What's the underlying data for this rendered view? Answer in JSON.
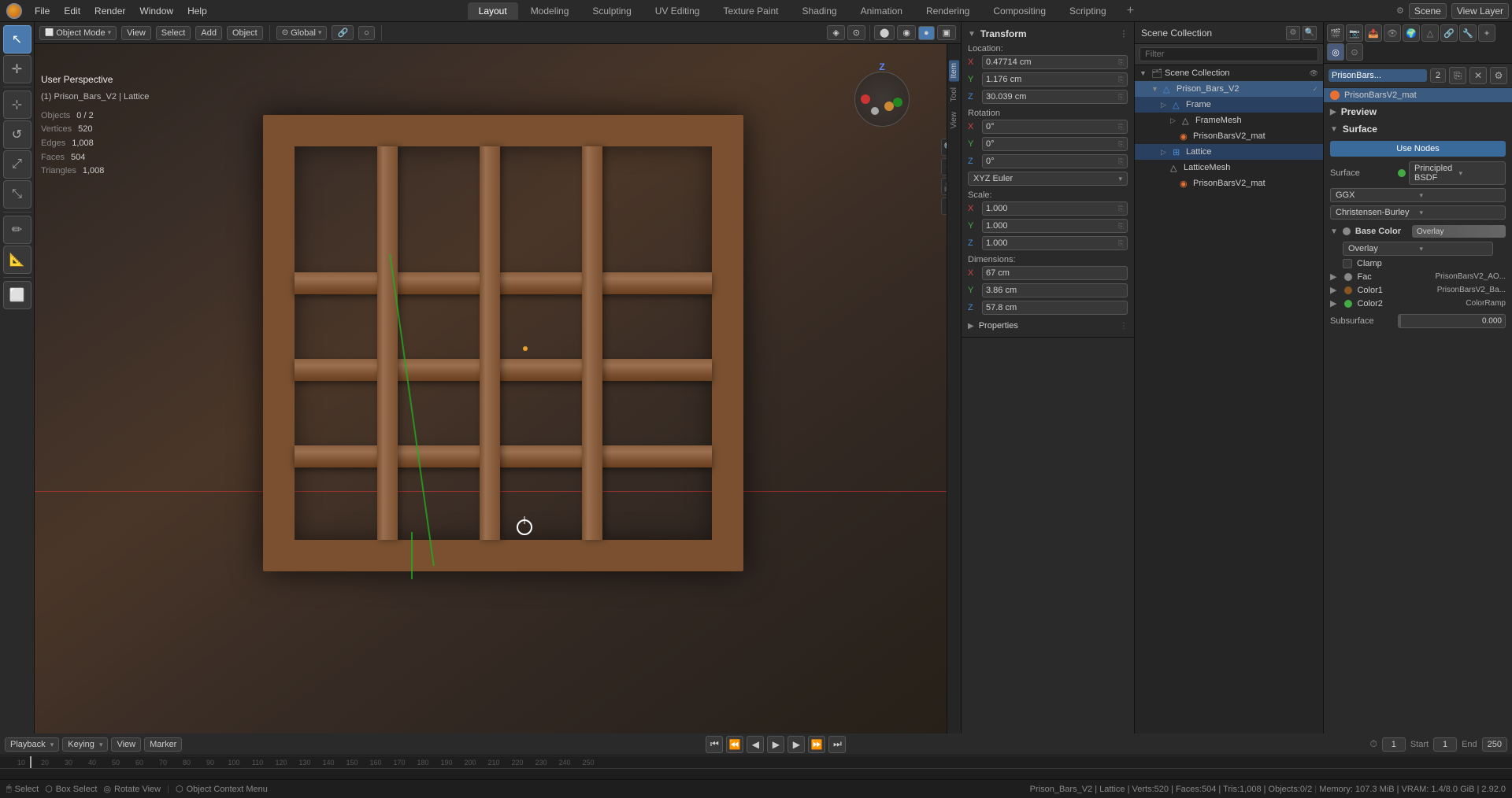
{
  "app": {
    "title": "Blender",
    "logo": "⬡"
  },
  "top_menu": {
    "items": [
      "Blender",
      "File",
      "Edit",
      "Render",
      "Window",
      "Help"
    ],
    "logo": "◉"
  },
  "workspace_tabs": [
    {
      "id": "layout",
      "label": "Layout",
      "active": true
    },
    {
      "id": "modeling",
      "label": "Modeling"
    },
    {
      "id": "sculpting",
      "label": "Sculpting"
    },
    {
      "id": "uv_editing",
      "label": "UV Editing"
    },
    {
      "id": "texture_paint",
      "label": "Texture Paint"
    },
    {
      "id": "shading",
      "label": "Shading"
    },
    {
      "id": "animation",
      "label": "Animation"
    },
    {
      "id": "rendering",
      "label": "Rendering"
    },
    {
      "id": "compositing",
      "label": "Compositing"
    },
    {
      "id": "scripting",
      "label": "Scripting"
    },
    {
      "id": "add",
      "label": "+"
    }
  ],
  "header_right": {
    "options": "Options",
    "scene": "Scene",
    "view_layer": "View Layer"
  },
  "viewport_header": {
    "mode": "Object Mode",
    "view": "View",
    "select": "Select",
    "add": "Add",
    "object": "Object",
    "pivot": "Global",
    "snap": "⊙",
    "proportional": "○"
  },
  "viewport_info": {
    "title": "User Perspective",
    "subtitle": "(1) Prison_Bars_V2 | Lattice",
    "objects_label": "Objects",
    "objects_value": "0 / 2",
    "vertices_label": "Vertices",
    "vertices_value": "520",
    "edges_label": "Edges",
    "edges_value": "1,008",
    "faces_label": "Faces",
    "faces_value": "504",
    "triangles_label": "Triangles",
    "triangles_value": "1,008"
  },
  "transform": {
    "title": "Transform",
    "location": {
      "label": "Location:",
      "x_label": "X",
      "x_value": "0.47714 cm",
      "y_label": "Y",
      "y_value": "1.176 cm",
      "z_label": "Z",
      "z_value": "30.039 cm"
    },
    "rotation": {
      "label": "Rotation",
      "x_label": "X",
      "x_value": "0°",
      "y_label": "Y",
      "y_value": "0°",
      "z_label": "Z",
      "z_value": "0°",
      "euler": "XYZ Euler"
    },
    "scale": {
      "label": "Scale:",
      "x_label": "X",
      "x_value": "1.000",
      "y_label": "Y",
      "y_value": "1.000",
      "z_label": "Z",
      "z_value": "1.000"
    },
    "dimensions": {
      "label": "Dimensions:",
      "x_label": "X",
      "x_value": "67 cm",
      "y_label": "Y",
      "y_value": "3.86 cm",
      "z_label": "Z",
      "z_value": "57.8 cm"
    },
    "properties": "Properties"
  },
  "outliner": {
    "title": "Scene Collection",
    "items": [
      {
        "id": "prison_bars_v2",
        "label": "Prison_Bars_V2",
        "icon": "▼",
        "indent": 0,
        "selected": true,
        "type": "object"
      },
      {
        "id": "frame",
        "label": "Frame",
        "icon": "▷",
        "indent": 1,
        "type": "mesh"
      },
      {
        "id": "framemesh",
        "label": "FrameMesh",
        "icon": "▷",
        "indent": 2,
        "type": "mesh"
      },
      {
        "id": "prisonbarsv2_mat_1",
        "label": "PrisonBarsV2_mat",
        "icon": "",
        "indent": 3,
        "type": "material"
      },
      {
        "id": "lattice",
        "label": "Lattice",
        "icon": "▷",
        "indent": 1,
        "type": "lattice"
      },
      {
        "id": "latticemesh",
        "label": "LatticeMesh",
        "icon": "",
        "indent": 2,
        "type": "mesh"
      },
      {
        "id": "prisonbarsv2_mat_2",
        "label": "PrisonBarsV2_mat",
        "icon": "",
        "indent": 3,
        "type": "material"
      }
    ]
  },
  "material_panel": {
    "object_name": "PrisonBars...",
    "material_slot": "2",
    "material_name": "PrisonBarsV2_mat",
    "preview_label": "Preview",
    "surface_label": "Surface",
    "use_nodes_btn": "Use Nodes",
    "surface_type_label": "Surface",
    "surface_type": "Principled BSDF",
    "distribution_label": "",
    "distribution": "GGX",
    "subsurface_method": "Christensen-Burley",
    "base_color_label": "Base Color",
    "base_color_value": "Overlay",
    "base_color_overlay": "Overlay",
    "clamp_label": "Clamp",
    "channels": [
      {
        "id": "fac",
        "label": "Fac",
        "color": "#888888",
        "value": "PrisonBarsV2_AO...",
        "dot_color": "#888"
      },
      {
        "id": "color1",
        "label": "Color1",
        "color": "#885522",
        "value": "PrisonBarsV2_Ba...",
        "dot_color": "#885522"
      },
      {
        "id": "color2",
        "label": "Color2",
        "color": "#44aa44",
        "value": "ColorRamp",
        "dot_color": "#44aa44"
      }
    ],
    "subsurface_label": "Subsurface",
    "subsurface_value": "0.000"
  },
  "timeline": {
    "playback_label": "Playback",
    "keying_label": "Keying",
    "view_label": "View",
    "marker_label": "Marker",
    "start": "1",
    "end": "250",
    "start_label": "Start",
    "end_label": "End",
    "frame_current": "1",
    "marks": [
      "10",
      "20",
      "30",
      "40",
      "50",
      "60",
      "70",
      "80",
      "90",
      "100",
      "110",
      "120",
      "130",
      "140",
      "150",
      "160",
      "170",
      "180",
      "190",
      "200",
      "210",
      "220",
      "230",
      "240",
      "250"
    ]
  },
  "status_bar": {
    "select": "Select",
    "box_select": "Box Select",
    "rotate_view": "Rotate View",
    "object_context": "Object Context Menu",
    "object_info": "Prison_Bars_V2 | Lattice | Verts:520 | Faces:504 | Tris:1,008 | Objects:0/2",
    "memory": "Memory: 107.3 MiB | VRAM: 1.4/8.0 GiB | 2.92.0"
  },
  "left_toolbar": {
    "tools": [
      {
        "id": "select",
        "icon": "↖",
        "active": true
      },
      {
        "id": "cursor",
        "icon": "✛"
      },
      {
        "id": "move",
        "icon": "✛"
      },
      {
        "id": "rotate",
        "icon": "↺"
      },
      {
        "id": "scale",
        "icon": "⤢"
      },
      {
        "id": "transform",
        "icon": "⤡"
      },
      {
        "id": "annotate",
        "icon": "✏"
      },
      {
        "id": "measure",
        "icon": "📏"
      },
      {
        "id": "cube_add",
        "icon": "⬜"
      }
    ]
  },
  "colors": {
    "accent_blue": "#4a7aad",
    "bg_dark": "#1e1e1e",
    "bg_panel": "#2a2a2a",
    "bg_header": "#252525",
    "border": "#333",
    "text_main": "#cccccc",
    "text_muted": "#888888",
    "x_axis": "#cc4444",
    "y_axis": "#44aa44",
    "z_axis": "#4488cc"
  }
}
